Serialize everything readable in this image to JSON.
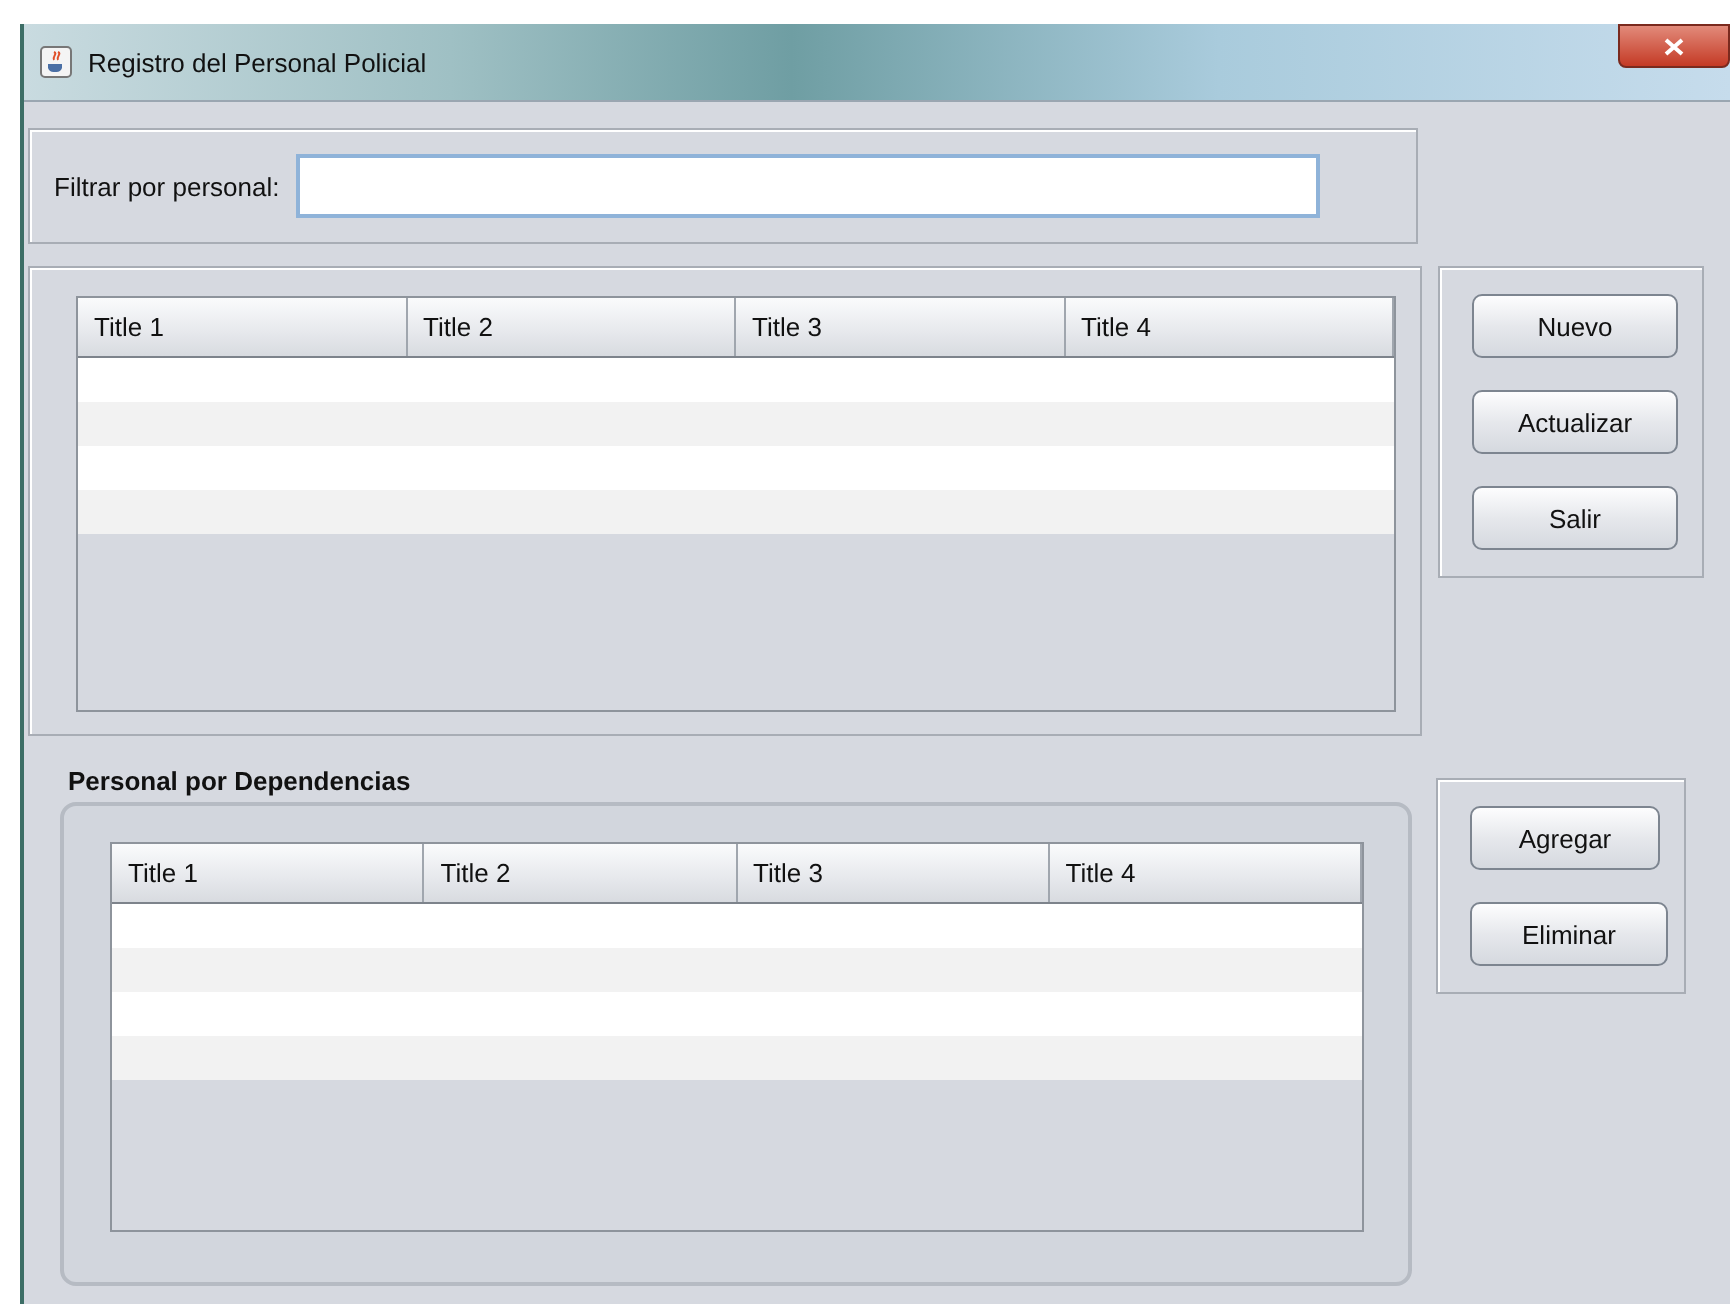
{
  "window": {
    "title": "Registro del Personal Policial"
  },
  "filter": {
    "label": "Filtrar por personal:"
  },
  "personal_table": {
    "columns": [
      "Title 1",
      "Title 2",
      "Title 3",
      "Title 4"
    ]
  },
  "personal_buttons": [
    "Nuevo",
    "Actualizar",
    "Salir"
  ],
  "dependencias": {
    "title": "Personal por Dependencias",
    "columns": [
      "Title 1",
      "Title 2",
      "Title 3",
      "Title 4"
    ]
  },
  "dependencias_buttons": [
    "Agregar",
    "Eliminar"
  ]
}
